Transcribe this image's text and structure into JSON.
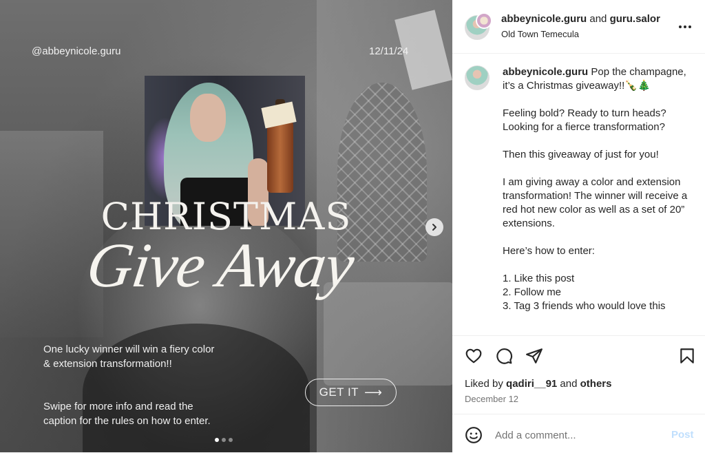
{
  "media": {
    "handle": "@abbeynicole.guru",
    "date": "12/11/24",
    "title_line1": "CHRISTMAS",
    "title_line2": "Give Away",
    "promo_line1": "One lucky winner will win a fiery color & extension transformation!!",
    "promo_line2": "Swipe for more info and read the caption for the rules on how to enter.",
    "cta_label": "GET IT",
    "cta_arrow": "⟶",
    "carousel_position": 1,
    "carousel_count": 3
  },
  "header": {
    "user1": "abbeynicole.guru",
    "and": " and ",
    "user2": "guru.salor",
    "location": "Old Town Temecula"
  },
  "caption": {
    "username": "abbeynicole.guru",
    "text": " Pop the champagne, it’s a Christmas giveaway!!🍾🎄\n\nFeeling bold? Ready to turn heads? Looking for a fierce transformation?\n\nThen this giveaway of just for you!\n\nI am giving away a color and extension transformation! The winner will receive a red hot new color as well as a set of 20” extensions.\n\nHere’s how to enter:\n\n1. Like this post\n2. Follow me\n3. Tag 3 friends who would love this"
  },
  "actions": {
    "liked_prefix": "Liked by ",
    "liked_user": "qadiri__91",
    "liked_and": " and ",
    "liked_others": "others",
    "date": "December 12"
  },
  "comment": {
    "placeholder": "Add a comment...",
    "post_label": "Post"
  },
  "icons": {
    "more": "more-horizontal-icon",
    "like": "heart-icon",
    "comment": "comment-icon",
    "share": "send-icon",
    "save": "bookmark-icon",
    "emoji": "emoji-icon",
    "next": "chevron-right-icon"
  },
  "colors": {
    "text": "#262626",
    "muted": "#737373",
    "post_disabled": "#c0dffd"
  }
}
